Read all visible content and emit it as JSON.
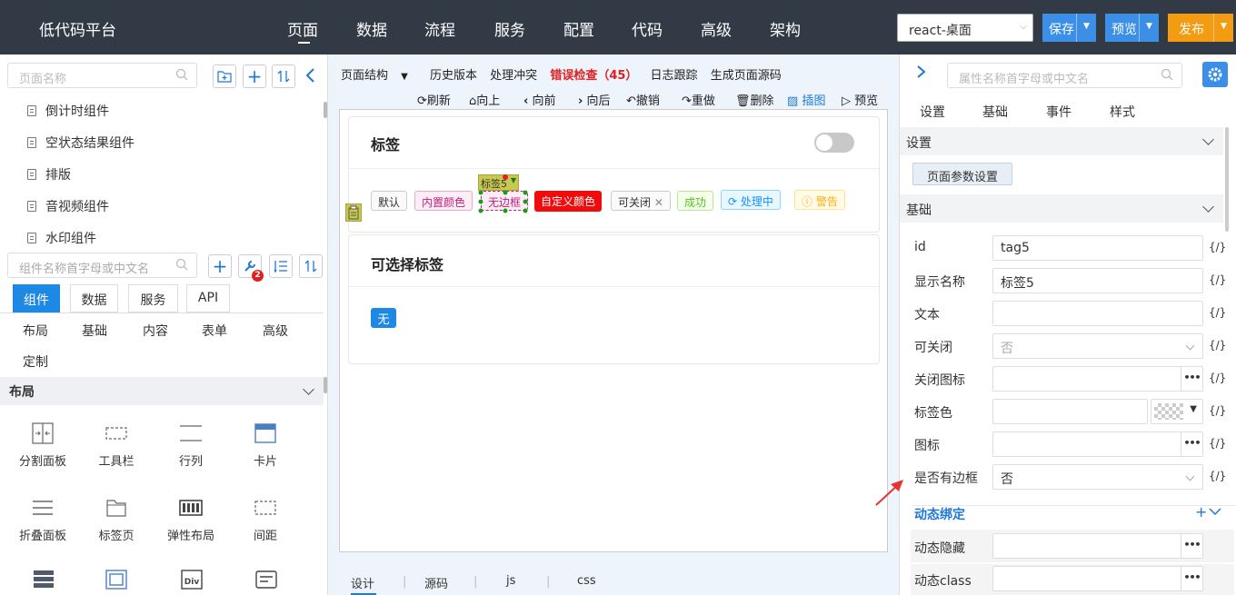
{
  "header": {
    "logo": "低代码平台",
    "nav": [
      "页面",
      "数据",
      "流程",
      "服务",
      "配置",
      "代码",
      "高级",
      "架构"
    ],
    "env_select": "react-桌面",
    "save_label": "保存",
    "preview_label": "预览",
    "publish_label": "发布",
    "colors": {
      "bar": "#323a45",
      "save": "#3b8fe6",
      "preview": "#3b8fe6",
      "publish": "#f39c12"
    }
  },
  "left": {
    "page_search_placeholder": "页面名称",
    "page_tree": [
      "倒计时组件",
      "空状态结果组件",
      "排版",
      "音视频组件",
      "水印组件"
    ],
    "comp_search_placeholder": "组件名称首字母或中文名",
    "badge_count": "2",
    "tabs": [
      "组件",
      "数据",
      "服务",
      "API"
    ],
    "categories": [
      "布局",
      "基础",
      "内容",
      "表单",
      "高级",
      "定制"
    ],
    "section_title": "布局",
    "components": [
      {
        "label": "分割面板",
        "icon": "split-panel-icon"
      },
      {
        "label": "工具栏",
        "icon": "toolbar-icon"
      },
      {
        "label": "行列",
        "icon": "row-col-icon"
      },
      {
        "label": "卡片",
        "icon": "card-icon"
      },
      {
        "label": "折叠面板",
        "icon": "collapse-icon"
      },
      {
        "label": "标签页",
        "icon": "tabs-icon"
      },
      {
        "label": "弹性布局",
        "icon": "flex-layout-icon"
      },
      {
        "label": "间距",
        "icon": "space-icon"
      }
    ]
  },
  "middle": {
    "toolbar": {
      "page_structure": "页面结构",
      "history": "历史版本",
      "conflicts": "处理冲突",
      "error_check": "错误检查（45）",
      "log_trace": "日志跟踪",
      "gen_source": "生成页面源码"
    },
    "actions": {
      "refresh": "刷新",
      "up": "向上",
      "forward": "向前",
      "back": "向后",
      "undo": "撤销",
      "redo": "重做",
      "delete": "删除",
      "screenshot": "插图",
      "preview": "预览"
    },
    "card1": {
      "title": "标签",
      "selected_label": "标签5",
      "tags": [
        {
          "text": "默认",
          "style": "default"
        },
        {
          "text": "内置颜色",
          "style": "pink"
        },
        {
          "text": "无边框",
          "style": "borderless"
        },
        {
          "text": "自定义颜色",
          "style": "custom"
        },
        {
          "text": "可关闭",
          "style": "closable"
        },
        {
          "text": "成功",
          "style": "success"
        },
        {
          "text": "处理中",
          "style": "processing"
        },
        {
          "text": "警告",
          "style": "warning"
        }
      ]
    },
    "card2": {
      "title": "可选择标签",
      "checked_tag": "无"
    },
    "bottom_tabs": [
      "设计",
      "源码",
      "js",
      "css"
    ]
  },
  "right": {
    "search_placeholder": "属性名称首字母或中文名",
    "tabs": [
      "设置",
      "基础",
      "事件",
      "样式"
    ],
    "sec_settings": "设置",
    "page_params_button": "页面参数设置",
    "sec_basic": "基础",
    "fx_label": "{/}",
    "props": {
      "id": {
        "label": "id",
        "value": "tag5"
      },
      "display_name": {
        "label": "显示名称",
        "value": "标签5"
      },
      "text": {
        "label": "文本",
        "value": ""
      },
      "closable": {
        "label": "可关闭",
        "value": "否"
      },
      "close_icon": {
        "label": "关闭图标",
        "value": ""
      },
      "tag_color": {
        "label": "标签色",
        "value": ""
      },
      "icon": {
        "label": "图标",
        "value": ""
      },
      "bordered": {
        "label": "是否有边框",
        "value": "否"
      }
    },
    "sec_dynamic": "动态绑定",
    "dynamic": {
      "hidden": {
        "label": "动态隐藏",
        "value": ""
      },
      "class": {
        "label": "动态class",
        "value": ""
      }
    }
  }
}
